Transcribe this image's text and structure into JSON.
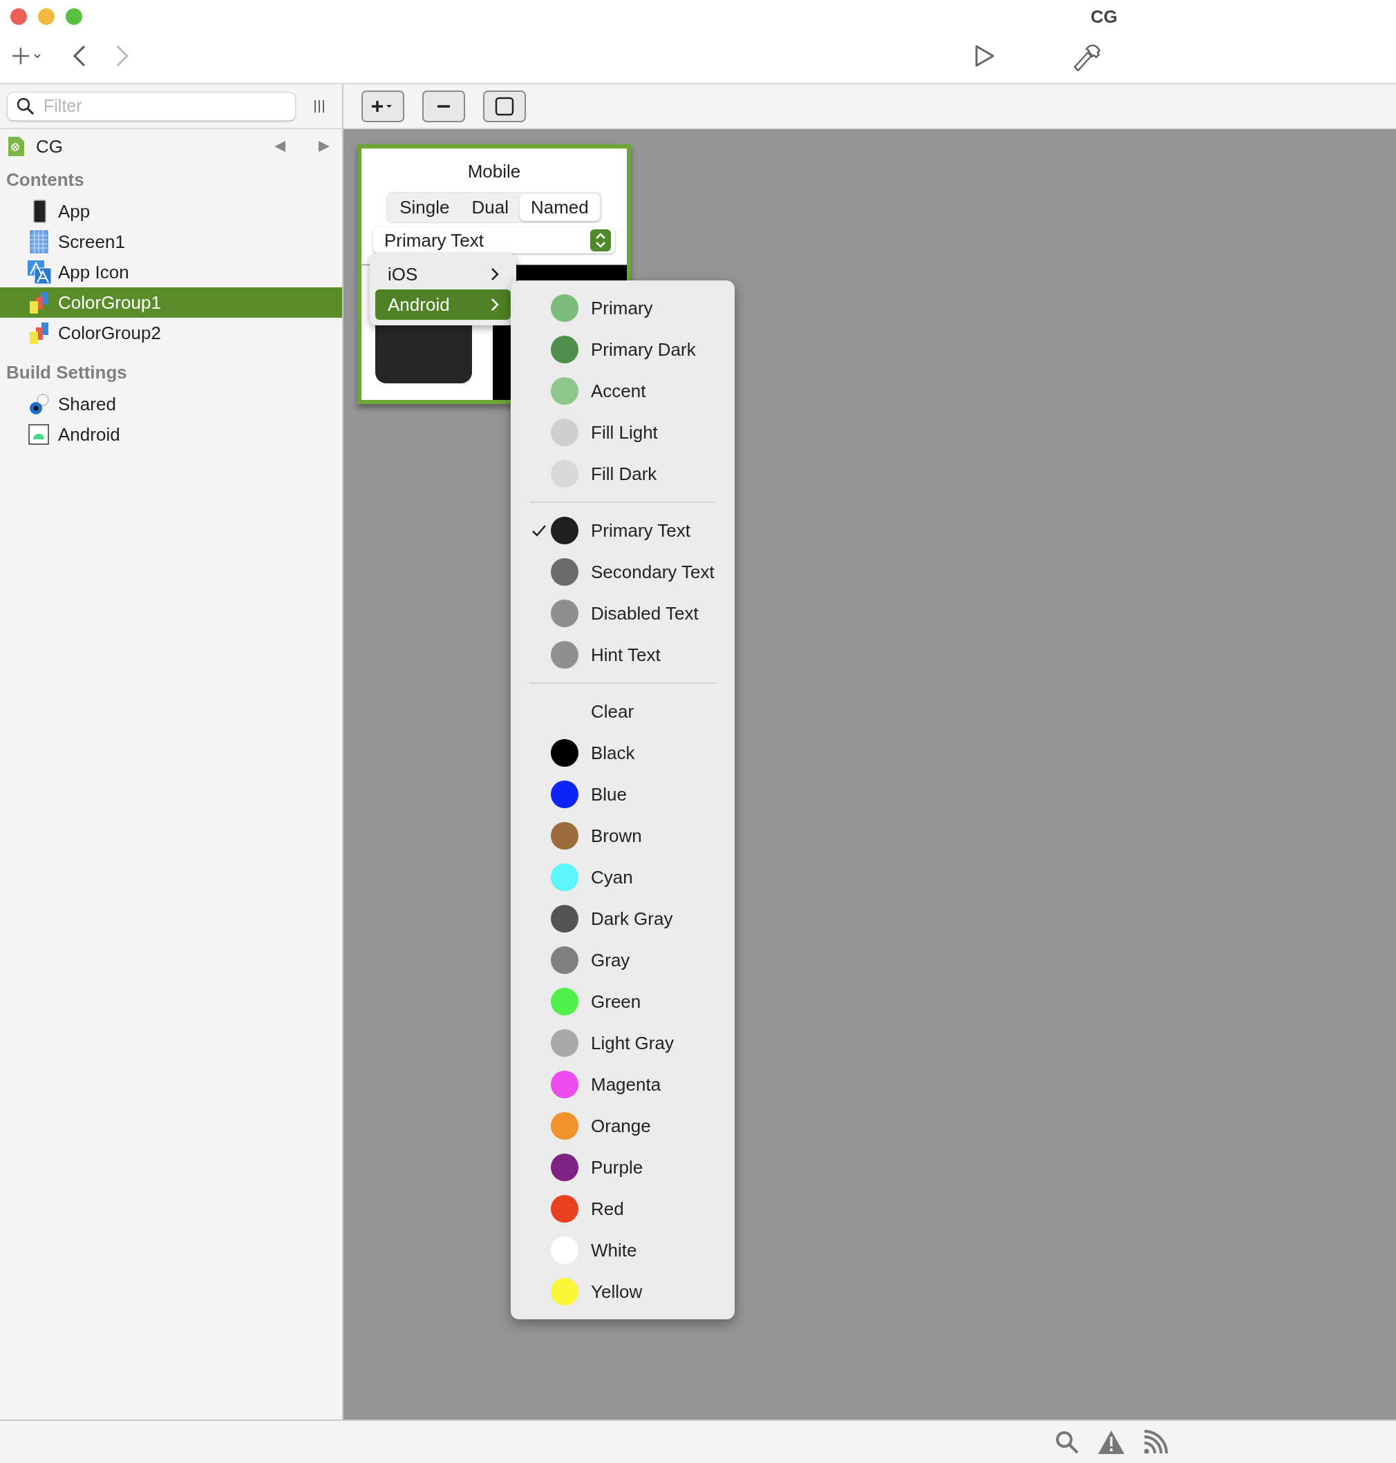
{
  "window": {
    "title": "CG"
  },
  "sidebar": {
    "filter": {
      "placeholder": "Filter"
    },
    "project": {
      "label": "CG"
    },
    "sections": [
      {
        "title": "Contents",
        "items": [
          {
            "label": "App",
            "kind": "phone",
            "selected": false
          },
          {
            "label": "Screen1",
            "kind": "grid",
            "selected": false
          },
          {
            "label": "App Icon",
            "kind": "appicon",
            "selected": false
          },
          {
            "label": "ColorGroup1",
            "kind": "colorgroup",
            "selected": true
          },
          {
            "label": "ColorGroup2",
            "kind": "colorgroup",
            "selected": false
          }
        ]
      },
      {
        "title": "Build Settings",
        "items": [
          {
            "label": "Shared",
            "kind": "shared",
            "selected": false
          },
          {
            "label": "Android",
            "kind": "android",
            "selected": false
          }
        ]
      }
    ]
  },
  "card": {
    "title": "Mobile",
    "segments": [
      {
        "label": "Single",
        "selected": false
      },
      {
        "label": "Dual",
        "selected": false
      },
      {
        "label": "Named",
        "selected": true
      }
    ],
    "dropdown": {
      "value": "Primary Text"
    }
  },
  "platform_menu": [
    {
      "label": "iOS",
      "selected": false
    },
    {
      "label": "Android",
      "selected": true
    }
  ],
  "color_menu": [
    [
      {
        "label": "Primary",
        "color": "#7bbb7b",
        "checked": false
      },
      {
        "label": "Primary Dark",
        "color": "#4e8f4b",
        "checked": false
      },
      {
        "label": "Accent",
        "color": "#8ec78c",
        "checked": false
      },
      {
        "label": "Fill Light",
        "color": "#cfcfcf",
        "checked": false
      },
      {
        "label": "Fill Dark",
        "color": "#d8d8d8",
        "checked": false
      }
    ],
    [
      {
        "label": "Primary Text",
        "color": "#1e1e1e",
        "checked": true
      },
      {
        "label": "Secondary Text",
        "color": "#6b6b6b",
        "checked": false
      },
      {
        "label": "Disabled Text",
        "color": "#8e8e8e",
        "checked": false
      },
      {
        "label": "Hint Text",
        "color": "#8f8f8f",
        "checked": false
      }
    ],
    [
      {
        "label": "Clear",
        "checked": false
      },
      {
        "label": "Black",
        "color": "#000000",
        "checked": false
      },
      {
        "label": "Blue",
        "color": "#0c24f5",
        "checked": false
      },
      {
        "label": "Brown",
        "color": "#9a6d3b",
        "checked": false
      },
      {
        "label": "Cyan",
        "color": "#5cf5fb",
        "checked": false
      },
      {
        "label": "Dark Gray",
        "color": "#545454",
        "checked": false
      },
      {
        "label": "Gray",
        "color": "#808080",
        "checked": false
      },
      {
        "label": "Green",
        "color": "#4ef04a",
        "checked": false
      },
      {
        "label": "Light Gray",
        "color": "#a9a9a9",
        "checked": false
      },
      {
        "label": "Magenta",
        "color": "#ef4cef",
        "checked": false
      },
      {
        "label": "Orange",
        "color": "#f2922a",
        "checked": false
      },
      {
        "label": "Purple",
        "color": "#7f2382",
        "checked": false
      },
      {
        "label": "Red",
        "color": "#ea3f1f",
        "checked": false
      },
      {
        "label": "White",
        "color": "#ffffff",
        "checked": false
      },
      {
        "label": "Yellow",
        "color": "#fbf637",
        "checked": false
      }
    ]
  ]
}
